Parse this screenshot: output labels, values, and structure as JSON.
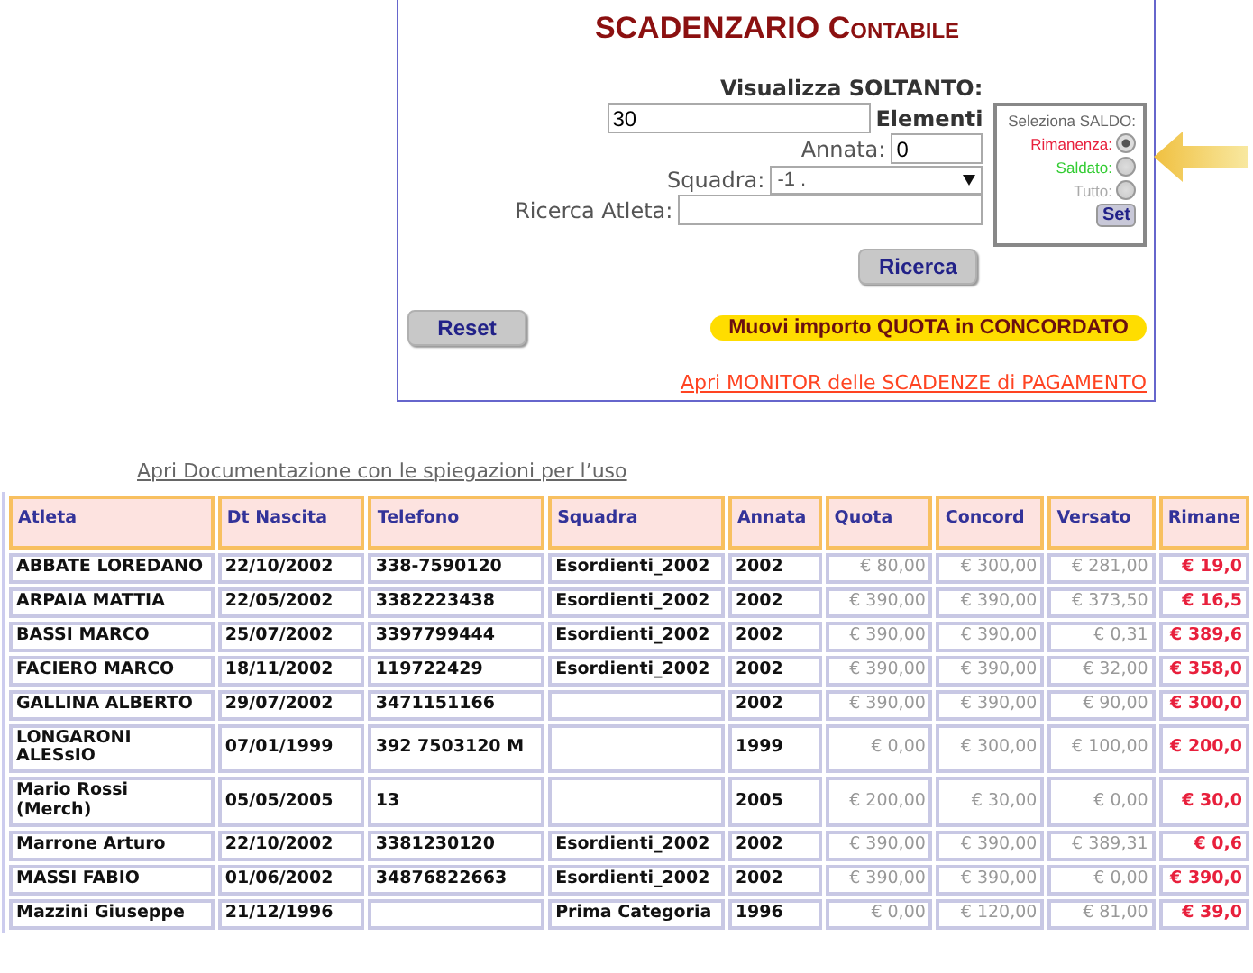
{
  "title": {
    "main": "SCADENZARIO",
    "small_caps": "Contabile"
  },
  "filters": {
    "heading": "Visualizza SOLTANTO:",
    "count_value": "30",
    "count_unit": "Elementi",
    "annata_label": "Annata:",
    "annata_value": "0",
    "squadra_label": "Squadra:",
    "squadra_value": "-1 .",
    "atleta_label": "Ricerca Atleta:"
  },
  "saldo": {
    "title": "Seleziona SALDO:",
    "options": [
      {
        "label": "Rimanenza:",
        "color": "#e8203c",
        "selected": true
      },
      {
        "label": "Saldato:",
        "color": "#33cc33",
        "selected": false
      },
      {
        "label": "Tutto:",
        "color": "#aaaaaa",
        "selected": false
      }
    ],
    "set_button": "Set"
  },
  "search_button": "Ricerca",
  "reset_button": "Reset",
  "move_button": "Muovi importo QUOTA in CONCORDATO",
  "monitor_link": "Apri MONITOR delle SCADENZE di PAGAMENTO",
  "doc_link": "Apri Documentazione con le spiegazioni per l’uso",
  "table": {
    "columns": [
      {
        "label": "Atleta",
        "kind": "text"
      },
      {
        "label": "Dt Nascita",
        "kind": "text"
      },
      {
        "label": "Telefono",
        "kind": "text"
      },
      {
        "label": "Squadra",
        "kind": "text"
      },
      {
        "label": "Annata",
        "kind": "text"
      },
      {
        "label": "Quota",
        "kind": "money"
      },
      {
        "label": "Concord",
        "kind": "money"
      },
      {
        "label": "Versato",
        "kind": "money"
      },
      {
        "label": "Rimane",
        "kind": "balance"
      }
    ],
    "rows": [
      [
        "ABBATE LOREDANO",
        "22/10/2002",
        "338-7590120",
        "Esordienti_2002",
        "2002",
        "€ 80,00",
        "€ 300,00",
        "€ 281,00",
        "€ 19,0"
      ],
      [
        "ARPAIA MATTIA",
        "22/05/2002",
        "3382223438",
        "Esordienti_2002",
        "2002",
        "€ 390,00",
        "€ 390,00",
        "€ 373,50",
        "€ 16,5"
      ],
      [
        "BASSI MARCO",
        "25/07/2002",
        "3397799444",
        "Esordienti_2002",
        "2002",
        "€ 390,00",
        "€ 390,00",
        "€ 0,31",
        "€ 389,6"
      ],
      [
        "FACIERO MARCO",
        "18/11/2002",
        "119722429",
        "Esordienti_2002",
        "2002",
        "€ 390,00",
        "€ 390,00",
        "€ 32,00",
        "€ 358,0"
      ],
      [
        "GALLINA ALBERTO",
        "29/07/2002",
        "3471151166",
        "",
        "2002",
        "€ 390,00",
        "€ 390,00",
        "€ 90,00",
        "€ 300,0"
      ],
      [
        "LONGARONI ALESsIO",
        "07/01/1999",
        "392 7503120 M",
        "",
        "1999",
        "€ 0,00",
        "€ 300,00",
        "€ 100,00",
        "€ 200,0"
      ],
      [
        "Mario Rossi (Merch)",
        "05/05/2005",
        "13",
        "",
        "2005",
        "€ 200,00",
        "€ 30,00",
        "€ 0,00",
        "€ 30,0"
      ],
      [
        "Marrone Arturo",
        "22/10/2002",
        "3381230120",
        "Esordienti_2002",
        "2002",
        "€ 390,00",
        "€ 390,00",
        "€ 389,31",
        "€ 0,6"
      ],
      [
        "MASSI FABIO",
        "01/06/2002",
        "34876822663",
        "Esordienti_2002",
        "2002",
        "€ 390,00",
        "€ 390,00",
        "€ 0,00",
        "€ 390,0"
      ],
      [
        "Mazzini Giuseppe",
        "21/12/1996",
        "",
        "Prima Categoria",
        "1996",
        "€ 0,00",
        "€ 120,00",
        "€ 81,00",
        "€ 39,0"
      ]
    ]
  }
}
